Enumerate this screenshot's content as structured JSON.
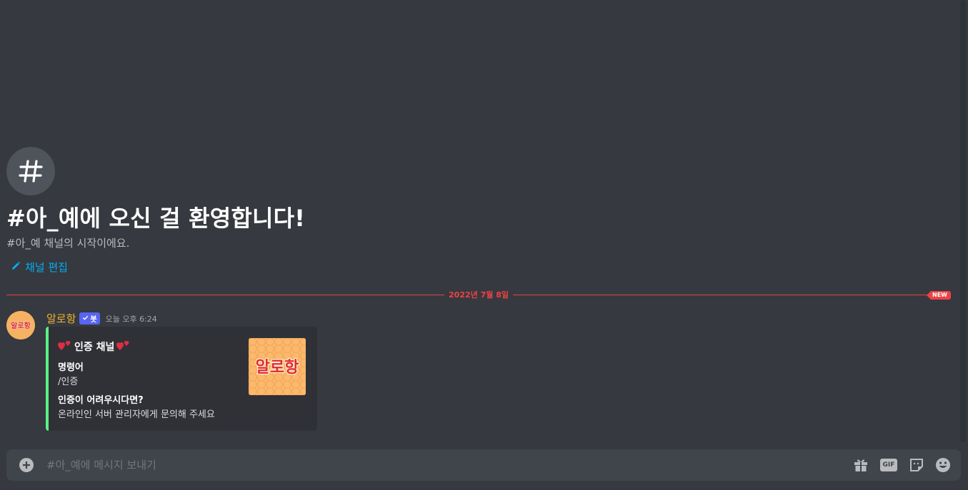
{
  "channel": {
    "welcome_icon_glyph": "#",
    "welcome_title": "#아_예에 오신 걸 환영합니다!",
    "welcome_subtitle": "#아_예 채널의 시작이에요.",
    "edit_label": "채널 편집"
  },
  "divider": {
    "date": "2022년 7월 8일",
    "new_badge": "NEW",
    "color": "#ed4245"
  },
  "message": {
    "avatar_text": "알로항",
    "username": "알로항",
    "bot_tag": "봇",
    "timestamp": "오늘 오후 6:24",
    "embed": {
      "accent_color": "#57f287",
      "title": "인증 채널",
      "thumbnail_text": "알로항",
      "fields": [
        {
          "name": "명령어",
          "value": "/인증"
        },
        {
          "name": "인증이 어려우시다면?",
          "value": "온라인인 서버 관리자에게 문의해 주세요"
        }
      ]
    }
  },
  "composer": {
    "placeholder": "#아_예에 메시지 보내기",
    "gif_label": "GIF",
    "icons": [
      "plus-circle-icon",
      "gift-icon",
      "gif-icon",
      "sticker-icon",
      "emoji-icon"
    ]
  }
}
